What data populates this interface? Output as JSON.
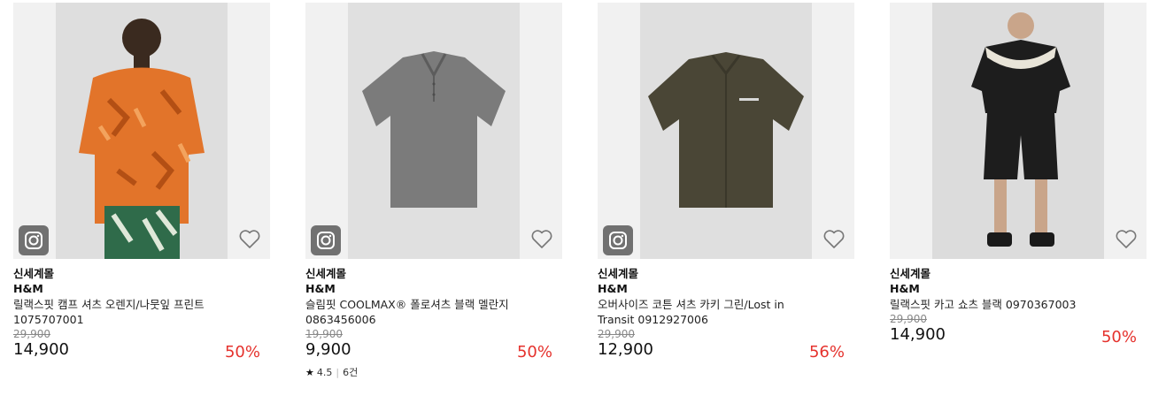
{
  "products": [
    {
      "store": "신세계몰",
      "brand": "H&M",
      "name": "릴랙스핏 캠프 셔츠 오렌지/나뭇잎 프린트 1075707001",
      "original_price": "29,900",
      "sale_price": "14,900",
      "discount": "50%",
      "has_camera_badge": true,
      "product_color": "#e2742a"
    },
    {
      "store": "신세계몰",
      "brand": "H&M",
      "name": "슬림핏 COOLMAX® 폴로셔츠 블랙 멜란지 0863456006",
      "original_price": "19,900",
      "sale_price": "9,900",
      "discount": "50%",
      "rating": "4.5",
      "review_count": "6건",
      "has_camera_badge": true,
      "product_color": "#7b7b7b"
    },
    {
      "store": "신세계몰",
      "brand": "H&M",
      "name": "오버사이즈 코튼 셔츠 카키 그린/Lost in Transit 0912927006",
      "original_price": "29,900",
      "sale_price": "12,900",
      "discount": "56%",
      "has_camera_badge": true,
      "product_color": "#4a4636"
    },
    {
      "store": "신세계몰",
      "brand": "H&M",
      "name": "릴랙스핏 카고 쇼츠 블랙 0970367003",
      "original_price": "29,900",
      "sale_price": "14,900",
      "discount": "50%",
      "has_camera_badge": false,
      "product_color": "#1d1d1d"
    }
  ],
  "colors": {
    "discount": "#e5322d",
    "thumb_bg": "#f1f1f1",
    "strike_price": "#888888"
  },
  "icons": {
    "camera": "camera-icon",
    "wishlist": "heart-outline-icon",
    "rating": "star-icon"
  }
}
